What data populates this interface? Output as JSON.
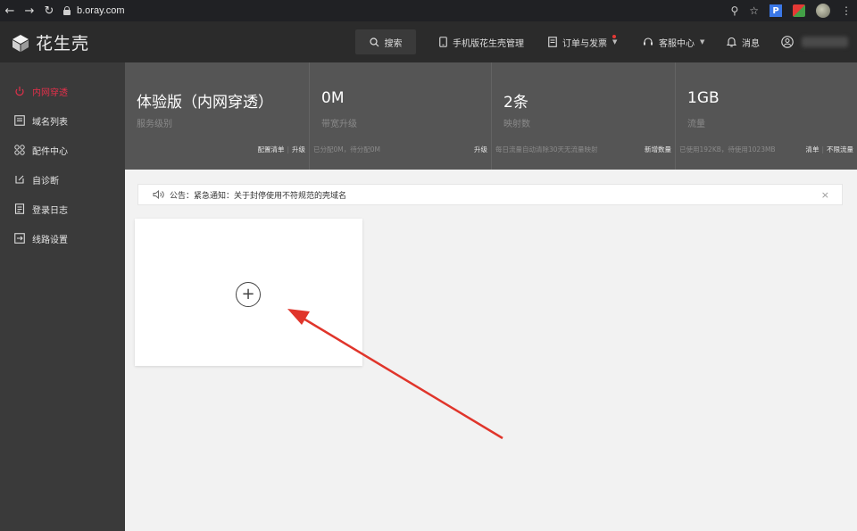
{
  "browser": {
    "url": "b.oray.com",
    "back_icon": "arrow-left-icon",
    "forward_icon": "arrow-right-icon",
    "reload_icon": "reload-icon",
    "ext_p_label": "P"
  },
  "app": {
    "logo_text": "花生壳",
    "search_label": "搜索",
    "nav": {
      "mobile": "手机版花生壳管理",
      "orders": "订单与发票",
      "service": "客服中心",
      "messages": "消息"
    }
  },
  "sidebar": {
    "items": [
      {
        "label": "内网穿透",
        "icon": "intranet-icon",
        "active": true
      },
      {
        "label": "域名列表",
        "icon": "list-icon",
        "active": false
      },
      {
        "label": "配件中心",
        "icon": "grid-icon",
        "active": false
      },
      {
        "label": "自诊断",
        "icon": "diagnose-icon",
        "active": false
      },
      {
        "label": "登录日志",
        "icon": "log-icon",
        "active": false
      },
      {
        "label": "线路设置",
        "icon": "route-icon",
        "active": false
      }
    ]
  },
  "stats": [
    {
      "value": "体验版（内网穿透）",
      "label": "服务级别",
      "foot_text": "",
      "links": [
        "配置清单",
        "升级"
      ]
    },
    {
      "value": "0M",
      "label": "带宽升级",
      "foot_text": "已分配0M，待分配0M",
      "links": [
        "升级"
      ]
    },
    {
      "value": "2条",
      "label": "映射数",
      "foot_text": "每日流量自动清除30天无流量映射",
      "links": [
        "新增数量"
      ]
    },
    {
      "value": "1GB",
      "label": "流量",
      "foot_text": "已使用192KB，待使用1023MB",
      "links": [
        "清单",
        "不限流量"
      ]
    }
  ],
  "notice": {
    "text": "公告：紧急通知：关于封停使用不符规范的壳域名",
    "close": "×"
  },
  "add_card": {
    "plus": "+"
  },
  "colors": {
    "accent": "#e0304a",
    "arrow": "#e0352b",
    "sidebar_bg": "#3a3a3a",
    "appbar_bg": "#2b2b2b",
    "stats_bg": "#555555"
  }
}
